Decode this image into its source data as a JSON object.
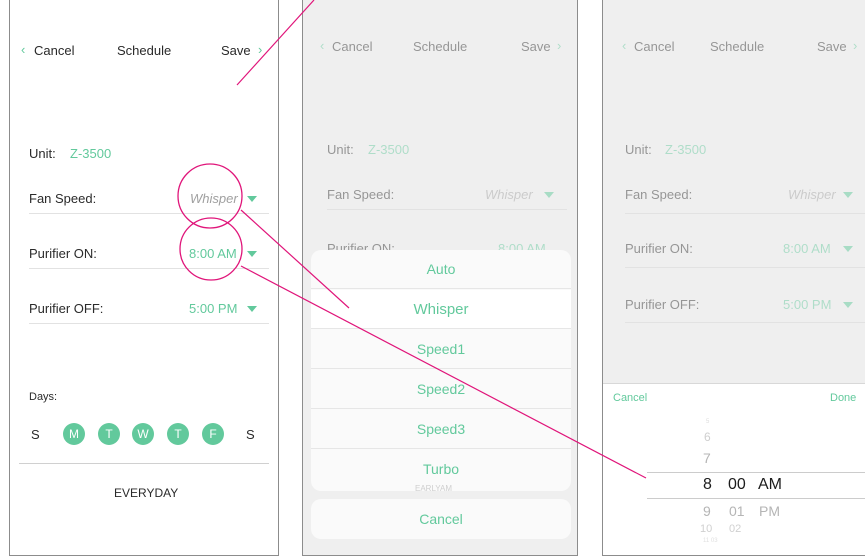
{
  "nav": {
    "cancel": "Cancel",
    "title": "Schedule",
    "save": "Save"
  },
  "unit": {
    "label": "Unit:",
    "value": "Z-3500"
  },
  "fan_speed": {
    "label": "Fan Speed:",
    "value": "Whisper"
  },
  "purifier_on": {
    "label": "Purifier ON:",
    "value": "8:00 AM"
  },
  "purifier_off": {
    "label": "Purifier OFF:",
    "value": "5:00 PM"
  },
  "days": {
    "label": "Days:",
    "letters": [
      "S",
      "M",
      "T",
      "W",
      "T",
      "F",
      "S"
    ],
    "everyday": "EVERYDAY"
  },
  "fan_menu": {
    "options": [
      "Auto",
      "Whisper",
      "Speed1",
      "Speed2",
      "Speed3",
      "Turbo"
    ],
    "selected": "Whisper",
    "partial_label": "EARLYAM",
    "cancel": "Cancel"
  },
  "time_picker": {
    "cancel": "Cancel",
    "done": "Done",
    "hours": [
      "6",
      "7",
      "8",
      "9",
      "10"
    ],
    "minutes": [
      "00",
      "01",
      "02"
    ],
    "periods": [
      "AM",
      "PM"
    ],
    "selected": {
      "hour": "8",
      "minute": "00",
      "period": "AM"
    }
  },
  "colors": {
    "accent": "#62c99c",
    "annotation": "#e0157a"
  }
}
